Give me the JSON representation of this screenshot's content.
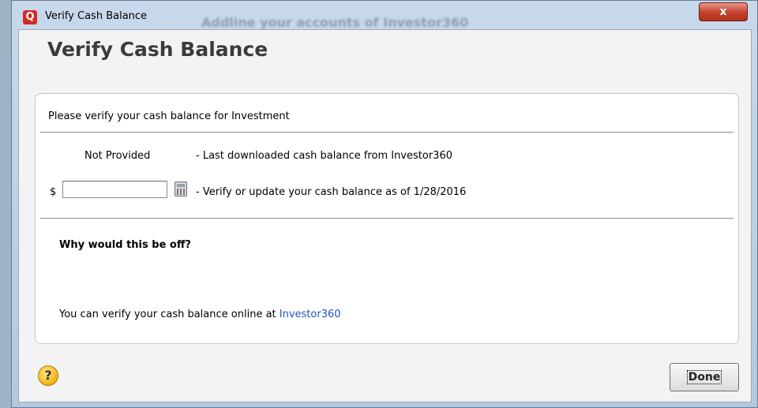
{
  "window": {
    "title": "Verify Cash Balance",
    "background_text": "Addline your accounts of Investor360",
    "close_label": "x"
  },
  "header": {
    "title": "Verify Cash Balance"
  },
  "panel": {
    "prompt": "Please verify your cash balance for Investment",
    "downloaded": {
      "value": "Not Provided",
      "description": "- Last downloaded cash balance from Investor360"
    },
    "input_row": {
      "currency_symbol": "$",
      "value": "",
      "description": "- Verify or update your cash balance as of 1/28/2016"
    },
    "why_heading": "Why would this be off?",
    "verify_text": "You can verify your cash balance online at ",
    "verify_link": "Investor360"
  },
  "footer": {
    "help_label": "?",
    "done_label": "Done"
  },
  "colors": {
    "link": "#1f55c4",
    "close": "#c74630",
    "help": "#f2b312"
  },
  "icons": {
    "app": "quicken-app-icon",
    "calculator": "calculator-icon",
    "help": "help-icon",
    "close": "close-icon"
  }
}
